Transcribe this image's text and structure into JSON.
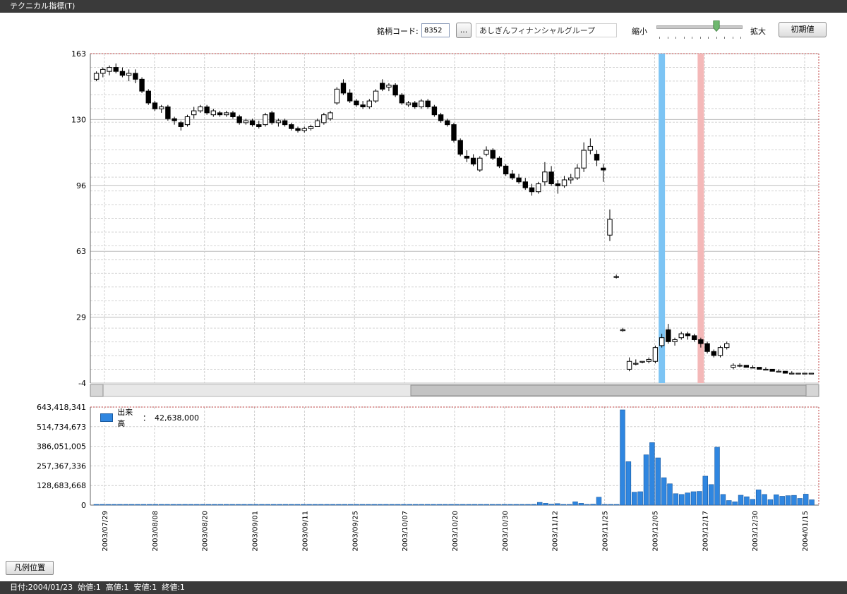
{
  "window": {
    "title": "テクニカル指標(T)"
  },
  "toolbar": {
    "code_label": "銘柄コード:",
    "code_value": "8352",
    "browse_label": "...",
    "company_name": "あしぎんフィナンシャルグループ",
    "zoom_out_label": "縮小",
    "zoom_in_label": "拡大",
    "reset_label": "初期値",
    "zoom_level": 0.72
  },
  "chart_data": [
    {
      "type": "candlestick",
      "title": "",
      "ylim": [
        -4,
        163
      ],
      "yticks": [
        "163",
        "130",
        "96",
        "63",
        "29",
        "-4"
      ],
      "x_dates": [
        "2003/07/29",
        "2003/08/08",
        "2003/08/20",
        "2003/09/01",
        "2003/09/11",
        "2003/09/25",
        "2003/10/07",
        "2003/10/20",
        "2003/10/30",
        "2003/11/12",
        "2003/11/25",
        "2003/12/05",
        "2003/12/17",
        "2003/12/30",
        "2004/01/15"
      ],
      "ohlc": [
        [
          150,
          154,
          149,
          153
        ],
        [
          153,
          156,
          151,
          155
        ],
        [
          154,
          157,
          152,
          156
        ],
        [
          156,
          158,
          153,
          154
        ],
        [
          154,
          156,
          151,
          152
        ],
        [
          152,
          155,
          149,
          153
        ],
        [
          153,
          155,
          148,
          150
        ],
        [
          150,
          151,
          143,
          144
        ],
        [
          144,
          145,
          137,
          138
        ],
        [
          138,
          139,
          134,
          135
        ],
        [
          135,
          137,
          133,
          136
        ],
        [
          136,
          137,
          129,
          130
        ],
        [
          130,
          131,
          127,
          129
        ],
        [
          128,
          129,
          124,
          126
        ],
        [
          127,
          132,
          126,
          131
        ],
        [
          132,
          136,
          130,
          134
        ],
        [
          134,
          137,
          133,
          136
        ],
        [
          136,
          137,
          132,
          133
        ],
        [
          132,
          135,
          131,
          134
        ],
        [
          133,
          134,
          131,
          132
        ],
        [
          132,
          134,
          131,
          133
        ],
        [
          133,
          134,
          130,
          131
        ],
        [
          131,
          132,
          127,
          128
        ],
        [
          128,
          130,
          127,
          129
        ],
        [
          129,
          130,
          126,
          127
        ],
        [
          127,
          129,
          125,
          126
        ],
        [
          127,
          133,
          126,
          132
        ],
        [
          133,
          134,
          127,
          128
        ],
        [
          128,
          130,
          126,
          129
        ],
        [
          129,
          130,
          126,
          127
        ],
        [
          127,
          128,
          124,
          125
        ],
        [
          125,
          126,
          123,
          124
        ],
        [
          124,
          126,
          123,
          125
        ],
        [
          125,
          127,
          124,
          126
        ],
        [
          126,
          130,
          126,
          129
        ],
        [
          128,
          133,
          127,
          132
        ],
        [
          130,
          134,
          129,
          133
        ],
        [
          138,
          146,
          137,
          145
        ],
        [
          148,
          150,
          142,
          143
        ],
        [
          143,
          145,
          138,
          139
        ],
        [
          139,
          140,
          136,
          137
        ],
        [
          137,
          139,
          135,
          136
        ],
        [
          136,
          140,
          135,
          139
        ],
        [
          139,
          145,
          138,
          144
        ],
        [
          148,
          150,
          144,
          145
        ],
        [
          146,
          148,
          144,
          147
        ],
        [
          147,
          148,
          141,
          142
        ],
        [
          142,
          143,
          137,
          138
        ],
        [
          137,
          139,
          136,
          138
        ],
        [
          138,
          139,
          135,
          136
        ],
        [
          136,
          140,
          135,
          139
        ],
        [
          139,
          140,
          135,
          136
        ],
        [
          136,
          137,
          131,
          132
        ],
        [
          132,
          133,
          128,
          129
        ],
        [
          129,
          130,
          126,
          127
        ],
        [
          127,
          128,
          118,
          119
        ],
        [
          119,
          120,
          111,
          112
        ],
        [
          111,
          114,
          108,
          110
        ],
        [
          110,
          112,
          106,
          107
        ],
        [
          104,
          111,
          103,
          110
        ],
        [
          112,
          116,
          111,
          114
        ],
        [
          114,
          115,
          109,
          110
        ],
        [
          110,
          111,
          105,
          106
        ],
        [
          106,
          107,
          101,
          102
        ],
        [
          102,
          104,
          99,
          100
        ],
        [
          100,
          102,
          97,
          98
        ],
        [
          98,
          100,
          94,
          95
        ],
        [
          95,
          97,
          91,
          93
        ],
        [
          93,
          98,
          92,
          97
        ],
        [
          98,
          108,
          96,
          103
        ],
        [
          103,
          106,
          96,
          97
        ],
        [
          97,
          99,
          92,
          96
        ],
        [
          96,
          101,
          95,
          99
        ],
        [
          99,
          102,
          97,
          100
        ],
        [
          100,
          107,
          99,
          105
        ],
        [
          105,
          118,
          103,
          114
        ],
        [
          114,
          120,
          112,
          116
        ],
        [
          112,
          114,
          106,
          109
        ],
        [
          105,
          107,
          98,
          104
        ],
        [
          71,
          84,
          68,
          79
        ],
        [
          50,
          51,
          49,
          50
        ],
        [
          23,
          24,
          22,
          23
        ],
        [
          3,
          9,
          2,
          7
        ],
        [
          6,
          8,
          5,
          6
        ],
        [
          7,
          7,
          6,
          7
        ],
        [
          7,
          9,
          6,
          8
        ],
        [
          7,
          15,
          6,
          14
        ],
        [
          15,
          21,
          14,
          19
        ],
        [
          23,
          26,
          16,
          17
        ],
        [
          17,
          19,
          15,
          18
        ],
        [
          19,
          22,
          18,
          21
        ],
        [
          21,
          22,
          18,
          20
        ],
        [
          20,
          21,
          17,
          18
        ],
        [
          18,
          19,
          14,
          16
        ],
        [
          16,
          17,
          11,
          12
        ],
        [
          12,
          13,
          9,
          10
        ],
        [
          10,
          15,
          9,
          14
        ],
        [
          14,
          17,
          13,
          16
        ],
        [
          4,
          6,
          3,
          5
        ],
        [
          5,
          6,
          4,
          5
        ],
        [
          5,
          5,
          4,
          4
        ],
        [
          4,
          5,
          4,
          4
        ],
        [
          4,
          4,
          3,
          3
        ],
        [
          3,
          4,
          3,
          3
        ],
        [
          3,
          3,
          2,
          2
        ],
        [
          2,
          3,
          2,
          2
        ],
        [
          2,
          2,
          1,
          1
        ],
        [
          1,
          2,
          1,
          1
        ],
        [
          1,
          1,
          1,
          1
        ],
        [
          1,
          1,
          1,
          1
        ],
        [
          1,
          1,
          1,
          1
        ]
      ],
      "highlight_bands": [
        {
          "label": "",
          "color": "#7cc4f4"
        },
        {
          "label": "",
          "color": "#f4b8b8"
        }
      ]
    },
    {
      "type": "bar",
      "title": "",
      "ylim": [
        0,
        643418341
      ],
      "yticks": [
        "643,418,341",
        "514,734,673",
        "386,051,005",
        "257,367,336",
        "128,683,668",
        "0"
      ],
      "series": [
        {
          "name": "出来高",
          "legend_value": "42,638,000",
          "color": "#2f86e0",
          "values": [
            2000000,
            2000000,
            2000000,
            2000000,
            2000000,
            2000000,
            2000000,
            2000000,
            2000000,
            2000000,
            2000000,
            2000000,
            2000000,
            2000000,
            2000000,
            2000000,
            2000000,
            2000000,
            2000000,
            2000000,
            2000000,
            2000000,
            2000000,
            2000000,
            2000000,
            2000000,
            2000000,
            2000000,
            2000000,
            2000000,
            2000000,
            2000000,
            2000000,
            2000000,
            2000000,
            2000000,
            2000000,
            2000000,
            2000000,
            2000000,
            2000000,
            2000000,
            2000000,
            2000000,
            2000000,
            2000000,
            2000000,
            2000000,
            2000000,
            2000000,
            2000000,
            2000000,
            2000000,
            2000000,
            2000000,
            2000000,
            2000000,
            2000000,
            2000000,
            2000000,
            2000000,
            2000000,
            2000000,
            2000000,
            2000000,
            2000000,
            2000000,
            2000000,
            2000000,
            2000000,
            2000000,
            2000000,
            2000000,
            2000000,
            5000000,
            18000000,
            12000000,
            6000000,
            10000000,
            4000000,
            3000000,
            22000000,
            12000000,
            3000000,
            6000000,
            52000000,
            3000000,
            4000000,
            3000000,
            625000000,
            285000000,
            85000000,
            88000000,
            330000000,
            410000000,
            310000000,
            180000000,
            140000000,
            75000000,
            70000000,
            80000000,
            88000000,
            90000000,
            190000000,
            135000000,
            380000000,
            70000000,
            30000000,
            22000000,
            65000000,
            55000000,
            38000000,
            100000000,
            70000000,
            36000000,
            68000000,
            58000000,
            62000000,
            64000000,
            44000000,
            72000000,
            35000000
          ]
        }
      ]
    }
  ],
  "legend_button": {
    "label": "凡例位置"
  },
  "status": {
    "text": "日付:2004/01/23  始値:1  高値:1  安値:1  終値:1"
  }
}
